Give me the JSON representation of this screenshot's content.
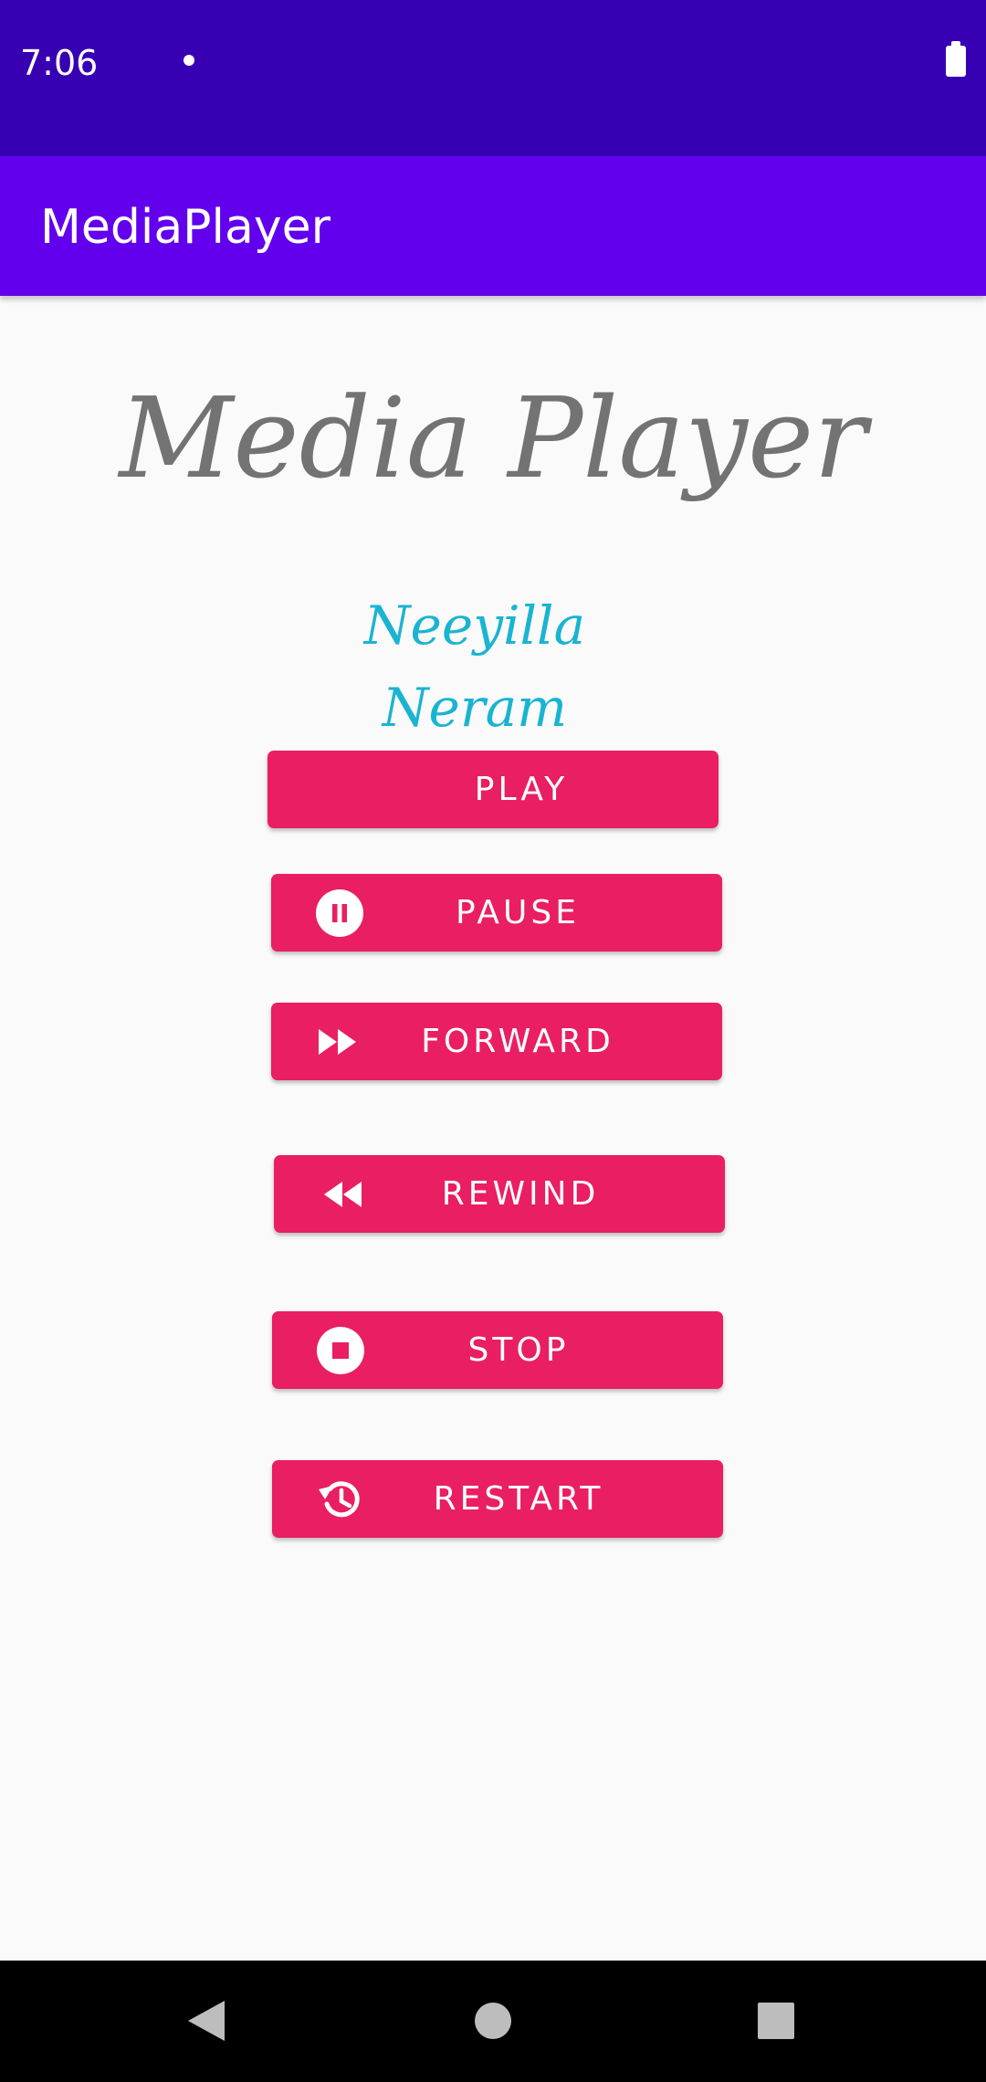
{
  "status_bar": {
    "time": "7:06",
    "icons": [
      "notification-dot-icon",
      "battery-icon"
    ]
  },
  "app_bar": {
    "title": "MediaPlayer"
  },
  "main": {
    "heading": "Media Player",
    "song_title": "Neeyilla Neram",
    "buttons": [
      {
        "label": "PLAY",
        "icon": null
      },
      {
        "label": "PAUSE",
        "icon": "pause-circle-icon"
      },
      {
        "label": "FORWARD",
        "icon": "fast-forward-icon"
      },
      {
        "label": "REWIND",
        "icon": "rewind-icon"
      },
      {
        "label": "STOP",
        "icon": "stop-circle-icon"
      },
      {
        "label": "RESTART",
        "icon": "history-icon"
      }
    ]
  },
  "nav_bar": {
    "icons": [
      "back-icon",
      "home-icon",
      "recents-icon"
    ]
  },
  "colors": {
    "status_bar": "#3700b3",
    "app_bar": "#6200ee",
    "button": "#e91e63",
    "heading_text": "#737373",
    "song_title_text": "#1ab4d1",
    "background": "#fafafa"
  }
}
